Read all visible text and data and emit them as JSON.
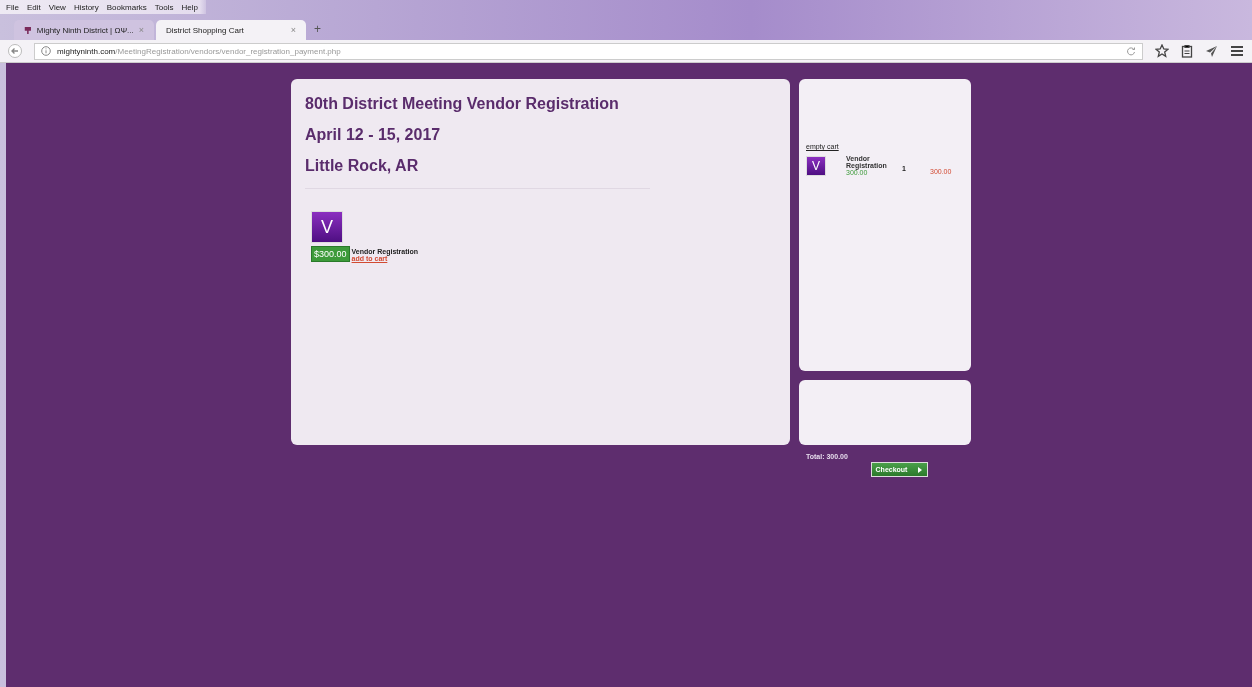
{
  "menu": [
    "File",
    "Edit",
    "View",
    "History",
    "Bookmarks",
    "Tools",
    "Help"
  ],
  "tabs": [
    {
      "label": "Mighty Ninth District | ΩΨ...",
      "close": "×",
      "selected": false
    },
    {
      "label": "District Shopping Cart",
      "close": "×",
      "selected": true
    }
  ],
  "new_tab": "+",
  "address": {
    "domain": "mightyninth.com",
    "path": "/MeetingRegistration/vendors/vendor_registration_payment.php"
  },
  "event": {
    "title": "80th District Meeting Vendor Registration",
    "dates": "April 12 - 15, 2017",
    "location": "Little Rock, AR"
  },
  "product": {
    "letter": "V",
    "price": "$300.00",
    "name": "Vendor Registration",
    "link": "add to cart"
  },
  "cart": {
    "empty_link": "empty cart",
    "items": [
      {
        "letter": "V",
        "name": "Vendor Registration",
        "unit_price": "300.00",
        "qty": "1",
        "line_total": "300.00"
      }
    ],
    "total": "Total: 300.00",
    "checkout": "Checkout"
  }
}
